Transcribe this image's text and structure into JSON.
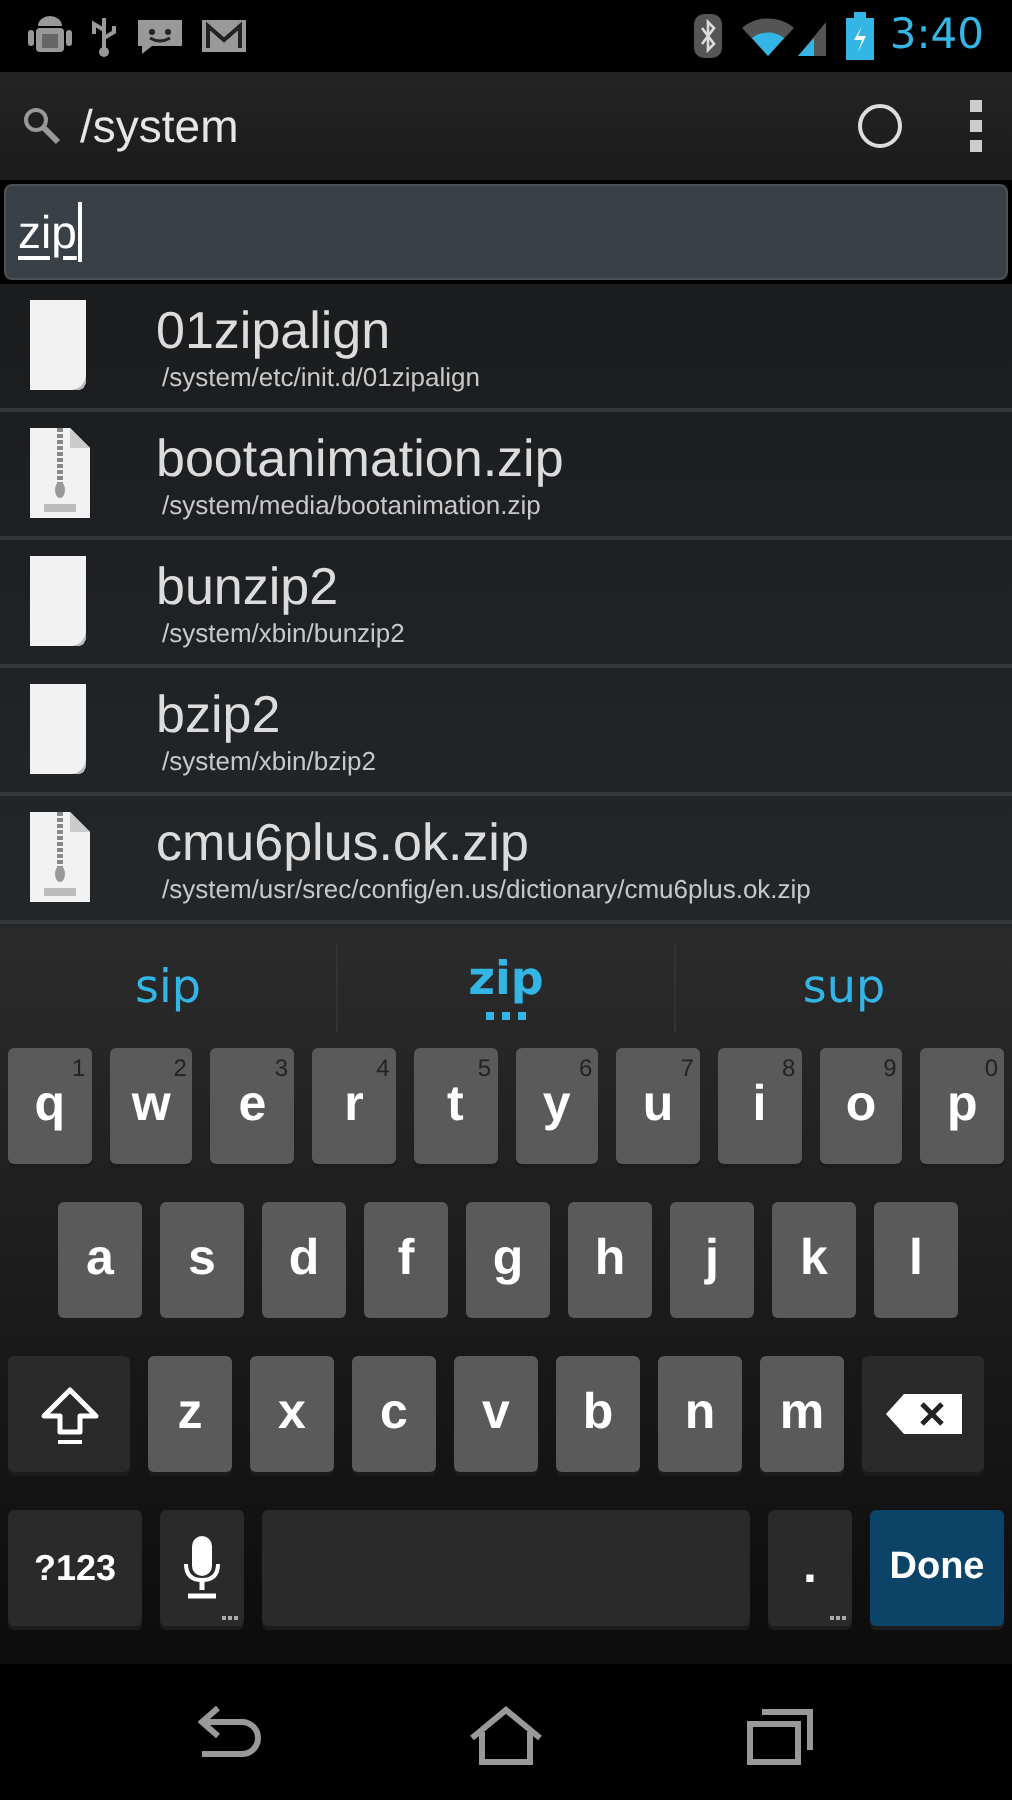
{
  "status_bar": {
    "time": "3:40"
  },
  "action_bar": {
    "title": "/system"
  },
  "search": {
    "value": "zip"
  },
  "files": [
    {
      "kind": "file",
      "name": "01zipalign",
      "path": "/system/etc/init.d/01zipalign"
    },
    {
      "kind": "zip",
      "name": "bootanimation.zip",
      "path": "/system/media/bootanimation.zip"
    },
    {
      "kind": "file",
      "name": "bunzip2",
      "path": "/system/xbin/bunzip2"
    },
    {
      "kind": "file",
      "name": "bzip2",
      "path": "/system/xbin/bzip2"
    },
    {
      "kind": "zip",
      "name": "cmu6plus.ok.zip",
      "path": "/system/usr/srec/config/en.us/dictionary/cmu6plus.ok.zip"
    }
  ],
  "suggestions": [
    {
      "text": "sip",
      "selected": false
    },
    {
      "text": "zip",
      "selected": true
    },
    {
      "text": "sup",
      "selected": false
    }
  ],
  "keyboard": [
    [
      {
        "kind": "letter",
        "label": "q",
        "hint": "1"
      },
      {
        "kind": "letter",
        "label": "w",
        "hint": "2"
      },
      {
        "kind": "letter",
        "label": "e",
        "hint": "3"
      },
      {
        "kind": "letter",
        "label": "r",
        "hint": "4"
      },
      {
        "kind": "letter",
        "label": "t",
        "hint": "5"
      },
      {
        "kind": "letter",
        "label": "y",
        "hint": "6"
      },
      {
        "kind": "letter",
        "label": "u",
        "hint": "7"
      },
      {
        "kind": "letter",
        "label": "i",
        "hint": "8"
      },
      {
        "kind": "letter",
        "label": "o",
        "hint": "9"
      },
      {
        "kind": "letter",
        "label": "p",
        "hint": "0"
      }
    ],
    [
      {
        "kind": "letter",
        "label": "a"
      },
      {
        "kind": "letter",
        "label": "s"
      },
      {
        "kind": "letter",
        "label": "d"
      },
      {
        "kind": "letter",
        "label": "f"
      },
      {
        "kind": "letter",
        "label": "g"
      },
      {
        "kind": "letter",
        "label": "h"
      },
      {
        "kind": "letter",
        "label": "j"
      },
      {
        "kind": "letter",
        "label": "k"
      },
      {
        "kind": "letter",
        "label": "l"
      }
    ],
    [
      {
        "kind": "shift"
      },
      {
        "kind": "letter",
        "label": "z"
      },
      {
        "kind": "letter",
        "label": "x"
      },
      {
        "kind": "letter",
        "label": "c"
      },
      {
        "kind": "letter",
        "label": "v"
      },
      {
        "kind": "letter",
        "label": "b"
      },
      {
        "kind": "letter",
        "label": "n"
      },
      {
        "kind": "letter",
        "label": "m"
      },
      {
        "kind": "delete"
      }
    ],
    [
      {
        "kind": "symbols",
        "label": "?123"
      },
      {
        "kind": "mic"
      },
      {
        "kind": "space"
      },
      {
        "kind": "period",
        "label": "."
      },
      {
        "kind": "done",
        "label": "Done"
      }
    ]
  ]
}
